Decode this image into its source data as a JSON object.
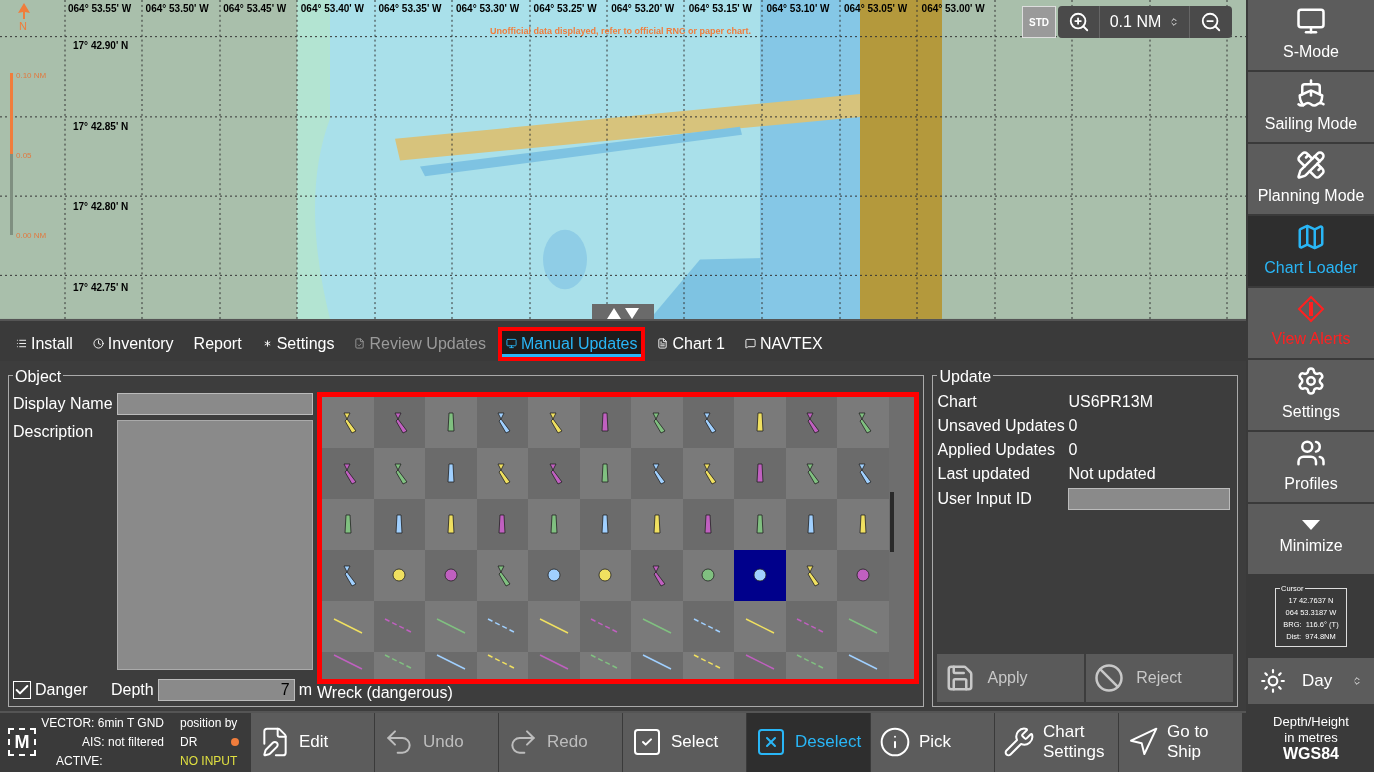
{
  "map": {
    "top_labels": [
      "064° 53.55' W",
      "064° 53.50' W",
      "064° 53.45' W",
      "064° 53.40' W",
      "064° 53.35' W",
      "064° 53.30' W",
      "064° 53.25' W",
      "064° 53.20' W",
      "064° 53.15' W",
      "064° 53.10' W",
      "064° 53.05' W",
      "064° 53.00' W"
    ],
    "left_labels": [
      "17° 42.90' N",
      "17° 42.85' N",
      "17° 42.80' N",
      "17° 42.75' N"
    ],
    "north_label": "N",
    "notice": "Unofficial data displayed, refer to official RNC or paper chart.",
    "distance_scale": [
      "0.10 NM",
      "0.05",
      "0.00 NM"
    ],
    "std_label": "STD",
    "range": "0.1 NM"
  },
  "sidebar": {
    "items": [
      {
        "label": "S-Mode",
        "selected": false,
        "alert": false
      },
      {
        "label": "Sailing Mode",
        "selected": false,
        "alert": false
      },
      {
        "label": "Planning Mode",
        "selected": false,
        "alert": false
      },
      {
        "label": "Chart Loader",
        "selected": true,
        "alert": false
      },
      {
        "label": "View Alerts",
        "selected": false,
        "alert": true
      },
      {
        "label": "Settings",
        "selected": false,
        "alert": false
      },
      {
        "label": "Profiles",
        "selected": false,
        "alert": false
      },
      {
        "label": "Minimize",
        "selected": false,
        "alert": false
      }
    ]
  },
  "cursor": {
    "title": "Cursor",
    "lines": [
      "17 42.7637 N",
      "064 53.3187 W",
      "BRG:  116.6° (T)",
      "Dist:  974.8NM"
    ]
  },
  "day_mode": "Day",
  "units": {
    "lines": [
      "Depth/Height",
      "in metres"
    ],
    "datum": "WGS84"
  },
  "tabs": [
    {
      "label": "Install",
      "selected": false,
      "disabled": false,
      "highlighted": false
    },
    {
      "label": "Inventory",
      "selected": false,
      "disabled": false,
      "highlighted": false
    },
    {
      "label": "Report",
      "selected": false,
      "disabled": false,
      "highlighted": false
    },
    {
      "label": "Settings",
      "selected": false,
      "disabled": false,
      "highlighted": false
    },
    {
      "label": "Review Updates",
      "selected": false,
      "disabled": true,
      "highlighted": false
    },
    {
      "label": "Manual Updates",
      "selected": true,
      "disabled": false,
      "highlighted": true
    },
    {
      "label": "Chart 1",
      "selected": false,
      "disabled": false,
      "highlighted": false
    },
    {
      "label": "NAVTEX",
      "selected": false,
      "disabled": false,
      "highlighted": false
    }
  ],
  "object_panel": {
    "title": "Object",
    "display_name_label": "Display Name",
    "description_label": "Description",
    "danger": {
      "label": "Danger",
      "checked": true
    },
    "depth": {
      "label": "Depth",
      "value": "7",
      "unit": "m"
    },
    "object_type": "Wreck (dangerous)"
  },
  "symbol_grid": {
    "highlighted": true,
    "rows": [
      {
        "cells": [
          {
            "selected": false
          },
          {
            "selected": false
          },
          {
            "selected": false
          },
          {
            "selected": false
          },
          {
            "selected": false
          },
          {
            "selected": false
          },
          {
            "selected": false
          },
          {
            "selected": false
          },
          {
            "selected": false
          },
          {
            "selected": false
          },
          {
            "selected": false
          }
        ]
      },
      {
        "cells": [
          {
            "selected": false
          },
          {
            "selected": false
          },
          {
            "selected": false
          },
          {
            "selected": false
          },
          {
            "selected": false
          },
          {
            "selected": false
          },
          {
            "selected": false
          },
          {
            "selected": false
          },
          {
            "selected": false
          },
          {
            "selected": false
          },
          {
            "selected": false
          }
        ]
      },
      {
        "cells": [
          {
            "selected": false
          },
          {
            "selected": false
          },
          {
            "selected": false
          },
          {
            "selected": false
          },
          {
            "selected": false
          },
          {
            "selected": false
          },
          {
            "selected": false
          },
          {
            "selected": false
          },
          {
            "selected": false
          },
          {
            "selected": false
          },
          {
            "selected": false
          }
        ]
      },
      {
        "cells": [
          {
            "selected": false
          },
          {
            "selected": false
          },
          {
            "selected": false
          },
          {
            "selected": false
          },
          {
            "selected": false
          },
          {
            "selected": false
          },
          {
            "selected": false
          },
          {
            "selected": false
          },
          {
            "selected": true
          },
          {
            "selected": false
          },
          {
            "selected": false
          }
        ]
      },
      {
        "cells": [
          {
            "selected": false
          },
          {
            "selected": false
          },
          {
            "selected": false
          },
          {
            "selected": false
          },
          {
            "selected": false
          },
          {
            "selected": false
          },
          {
            "selected": false
          },
          {
            "selected": false
          },
          {
            "selected": false
          },
          {
            "selected": false
          },
          {
            "selected": false
          }
        ]
      },
      {
        "cells": [
          {
            "selected": false
          },
          {
            "selected": false
          },
          {
            "selected": false
          },
          {
            "selected": false
          },
          {
            "selected": false
          },
          {
            "selected": false
          },
          {
            "selected": false
          },
          {
            "selected": false
          },
          {
            "selected": false
          },
          {
            "selected": false
          },
          {
            "selected": false
          }
        ]
      }
    ]
  },
  "update_panel": {
    "title": "Update",
    "fields": [
      {
        "label": "Chart",
        "value": "US6PR13M"
      },
      {
        "label": "Unsaved Updates",
        "value": "0"
      },
      {
        "label": "Applied Updates",
        "value": "0"
      },
      {
        "label": "Last updated",
        "value": "Not updated"
      }
    ],
    "user_input_label": "User Input ID",
    "buttons": [
      "Apply",
      "Reject"
    ]
  },
  "status": {
    "logo": "M",
    "vector": "VECTOR: 6min T GND",
    "ais": "AIS: not filtered",
    "active": "ACTIVE:",
    "position_label": "position by",
    "position_source": "DR",
    "input_state": "NO INPUT"
  },
  "toolbar": [
    {
      "label": "Edit",
      "selected": false,
      "disabled": false
    },
    {
      "label": "Undo",
      "selected": false,
      "disabled": true
    },
    {
      "label": "Redo",
      "selected": false,
      "disabled": true
    },
    {
      "label": "Select",
      "selected": false,
      "disabled": false
    },
    {
      "label": "Deselect",
      "selected": true,
      "disabled": false
    },
    {
      "label": "Pick",
      "selected": false,
      "disabled": false
    },
    {
      "label": "Chart Settings",
      "selected": false,
      "disabled": false
    },
    {
      "label": "Go to Ship",
      "selected": false,
      "disabled": false
    }
  ]
}
